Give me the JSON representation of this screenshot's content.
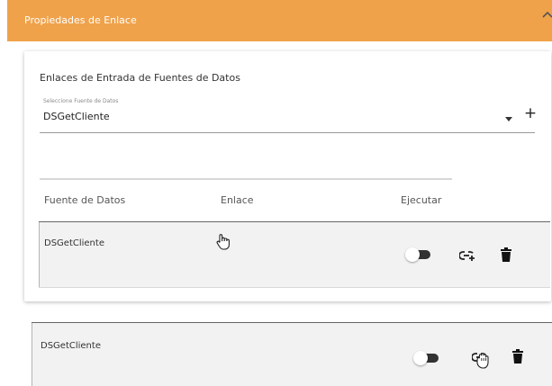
{
  "panel": {
    "title": "Propiedades de Enlace",
    "header_color": "#f0a24a",
    "collapse_icon": "chevron-up-icon"
  },
  "card": {
    "section_title": "Enlaces de Entrada de Fuentes de Datos",
    "select": {
      "label": "Seleccione Fuente de Datos",
      "value": "DSGetCliente",
      "arrow_icon": "dropdown-arrow-icon",
      "add_label": "+"
    },
    "table": {
      "columns": [
        "Fuente de Datos",
        "Enlace",
        "Ejecutar"
      ],
      "rows": [
        {
          "name": "DSGetCliente",
          "execute": false,
          "link_icon": "add-link-icon",
          "delete_icon": "trash-icon"
        }
      ]
    }
  },
  "drag_preview": {
    "name": "DSGetCliente",
    "execute": false,
    "link_icon": "add-link-icon",
    "delete_icon": "trash-icon",
    "cursor_icon": "grab-hand-cursor-icon"
  },
  "colors": {
    "accent": "#f0a24a",
    "toggle_track": "#323232",
    "row_background": "#f2f2f2"
  }
}
